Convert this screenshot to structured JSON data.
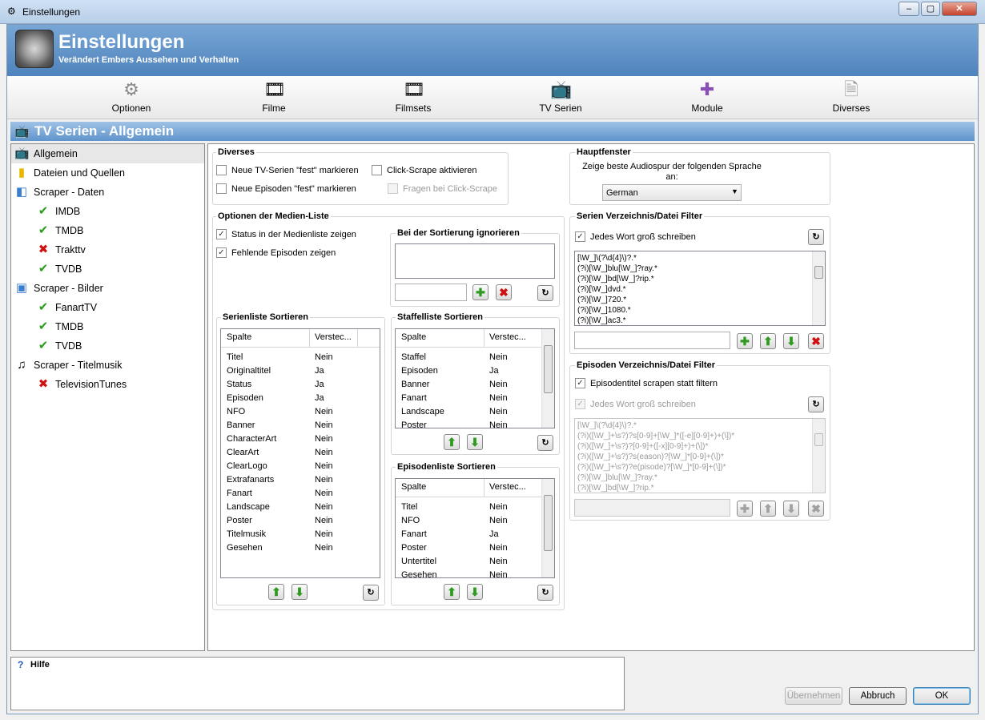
{
  "window": {
    "title": "Einstellungen"
  },
  "header": {
    "title": "Einstellungen",
    "subtitle": "Verändert Embers Aussehen und Verhalten"
  },
  "toolbar": {
    "items": [
      {
        "label": "Optionen",
        "icon": "gear-icon"
      },
      {
        "label": "Filme",
        "icon": "film-icon"
      },
      {
        "label": "Filmsets",
        "icon": "filmsets-icon"
      },
      {
        "label": "TV Serien",
        "icon": "tv-icon"
      },
      {
        "label": "Module",
        "icon": "puzzle-icon"
      },
      {
        "label": "Diverses",
        "icon": "document-icon"
      }
    ]
  },
  "section": {
    "title": "TV Serien - Allgemein"
  },
  "sidebar": {
    "items": [
      {
        "label": "Allgemein",
        "icon": "tv-icon"
      },
      {
        "label": "Dateien und Quellen",
        "icon": "folder-icon"
      },
      {
        "label": "Scraper - Daten",
        "icon": "scraper-data-icon"
      },
      {
        "label": "IMDB",
        "icon": "check-icon"
      },
      {
        "label": "TMDB",
        "icon": "check-icon"
      },
      {
        "label": "Trakttv",
        "icon": "cross-icon"
      },
      {
        "label": "TVDB",
        "icon": "check-icon"
      },
      {
        "label": "Scraper - Bilder",
        "icon": "scraper-images-icon"
      },
      {
        "label": "FanartTV",
        "icon": "check-icon"
      },
      {
        "label": "TMDB",
        "icon": "check-icon"
      },
      {
        "label": "TVDB",
        "icon": "check-icon"
      },
      {
        "label": "Scraper - Titelmusik",
        "icon": "music-icon"
      },
      {
        "label": "TelevisionTunes",
        "icon": "cross-icon"
      }
    ]
  },
  "diverses": {
    "title": "Diverses",
    "new_series_fest": "Neue TV-Serien \"fest\" markieren",
    "new_episodes_fest": "Neue Episoden \"fest\" markieren",
    "click_scrape": "Click-Scrape aktivieren",
    "ask_click_scrape": "Fragen bei Click-Scrape"
  },
  "medialist": {
    "title": "Optionen der Medien-Liste",
    "status": "Status in der Medienliste zeigen",
    "missing_episodes": "Fehlende Episoden zeigen"
  },
  "sortignore": {
    "title": "Bei der Sortierung ignorieren"
  },
  "hauptfenster": {
    "title": "Hauptfenster",
    "audio_label": "Zeige beste Audiospur der folgenden Sprache an:",
    "language": "German"
  },
  "seriesfilter": {
    "title": "Serien Verzeichnis/Datei Filter",
    "capitalize": "Jedes Wort groß schreiben",
    "entries": [
      "[\\W_]\\(?\\d{4}\\)?.*",
      "(?i)[\\W_]blu[\\W_]?ray.*",
      "(?i)[\\W_]bd[\\W_]?rip.*",
      "(?i)[\\W_]dvd.*",
      "(?i)[\\W_]720.*",
      "(?i)[\\W_]1080.*",
      "(?i)[\\W_]ac3.*"
    ]
  },
  "episodefilter": {
    "title": "Episoden Verzeichnis/Datei Filter",
    "scrape_titles": "Episodentitel scrapen statt filtern",
    "capitalize": "Jedes Wort groß schreiben",
    "entries": [
      "[\\W_]\\(?\\d{4}\\)?.*",
      "(?i)([\\W_]+\\s?)?s[0-9]+[\\W_]*([-e][0-9]+)+(\\])*",
      "(?i)([\\W_]+\\s?)?[0-9]+([-x][0-9]+)+(\\])*",
      "(?i)([\\W_]+\\s?)?s(eason)?[\\W_]*[0-9]+(\\])*",
      "(?i)([\\W_]+\\s?)?e(pisode)?[\\W_]*[0-9]+(\\])*",
      "(?i)[\\W_]blu[\\W_]?ray.*",
      "(?i)[\\W_]bd[\\W_]?rip.*"
    ]
  },
  "serienliste": {
    "title": "Serienliste Sortieren",
    "col1": "Spalte",
    "col2": "Verstec...",
    "rows": [
      [
        "Titel",
        "Nein"
      ],
      [
        "Originaltitel",
        "Ja"
      ],
      [
        "Status",
        "Ja"
      ],
      [
        "Episoden",
        "Ja"
      ],
      [
        "NFO",
        "Nein"
      ],
      [
        "Banner",
        "Nein"
      ],
      [
        "CharacterArt",
        "Nein"
      ],
      [
        "ClearArt",
        "Nein"
      ],
      [
        "ClearLogo",
        "Nein"
      ],
      [
        "Extrafanarts",
        "Nein"
      ],
      [
        "Fanart",
        "Nein"
      ],
      [
        "Landscape",
        "Nein"
      ],
      [
        "Poster",
        "Nein"
      ],
      [
        "Titelmusik",
        "Nein"
      ],
      [
        "Gesehen",
        "Nein"
      ]
    ]
  },
  "staffelliste": {
    "title": "Staffelliste Sortieren",
    "col1": "Spalte",
    "col2": "Verstec...",
    "rows": [
      [
        "Staffel",
        "Nein"
      ],
      [
        "Episoden",
        "Ja"
      ],
      [
        "Banner",
        "Nein"
      ],
      [
        "Fanart",
        "Nein"
      ],
      [
        "Landscape",
        "Nein"
      ],
      [
        "Poster",
        "Nein"
      ]
    ]
  },
  "episodenliste": {
    "title": "Episodenliste Sortieren",
    "col1": "Spalte",
    "col2": "Verstec...",
    "rows": [
      [
        "Titel",
        "Nein"
      ],
      [
        "NFO",
        "Nein"
      ],
      [
        "Fanart",
        "Ja"
      ],
      [
        "Poster",
        "Nein"
      ],
      [
        "Untertitel",
        "Nein"
      ],
      [
        "Gesehen",
        "Nein"
      ]
    ]
  },
  "help": {
    "title": "Hilfe"
  },
  "buttons": {
    "apply": "Übernehmen",
    "cancel": "Abbruch",
    "ok": "OK"
  }
}
